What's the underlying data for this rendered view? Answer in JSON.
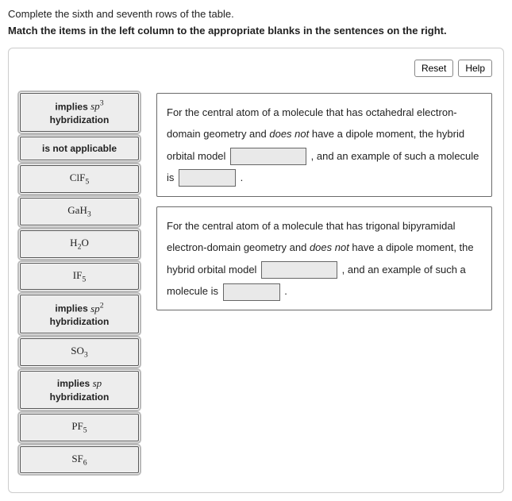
{
  "instructions": {
    "line1": "Complete the sixth and seventh rows of the table.",
    "line2": "Match the items in the left column to the appropriate blanks in the sentences on the right."
  },
  "buttons": {
    "reset": "Reset",
    "help": "Help"
  },
  "tiles": [
    {
      "html": "<b>implies</b> <span class='serif'><i>sp</i><sup>3</sup></span><br><b>hybridization</b>"
    },
    {
      "html": "<b>is not applicable</b>"
    },
    {
      "html": "<span class='serif'>ClF<sub>5</sub></span>"
    },
    {
      "html": "<span class='serif'>GaH<sub>3</sub></span>"
    },
    {
      "html": "<span class='serif'>H<sub>2</sub>O</span>"
    },
    {
      "html": "<span class='serif'>IF<sub>5</sub></span>"
    },
    {
      "html": "<b>implies</b> <span class='serif'><i>sp</i><sup>2</sup></span><br><b>hybridization</b>"
    },
    {
      "html": "<span class='serif'>SO<sub>3</sub></span>"
    },
    {
      "html": "<b>implies</b> <span class='serif'><i>sp</i></span><br><b>hybridization</b>"
    },
    {
      "html": "<span class='serif'>PF<sub>5</sub></span>"
    },
    {
      "html": "<span class='serif'>SF<sub>6</sub></span>"
    }
  ],
  "sentence1": {
    "part1": "For the central atom of a molecule that has octahedral electron-domain geometry and ",
    "em1": "does not",
    "part2": " have a dipole moment, the hybrid orbital model ",
    "part3": " , and an example of such a molecule is ",
    "part4": " ."
  },
  "sentence2": {
    "part1": "For the central atom of a molecule that has trigonal bipyramidal electron-domain geometry and ",
    "em1": "does not",
    "part2": " have a dipole moment, the hybrid orbital model ",
    "part3": " , and an example of such a molecule is ",
    "part4": " ."
  }
}
